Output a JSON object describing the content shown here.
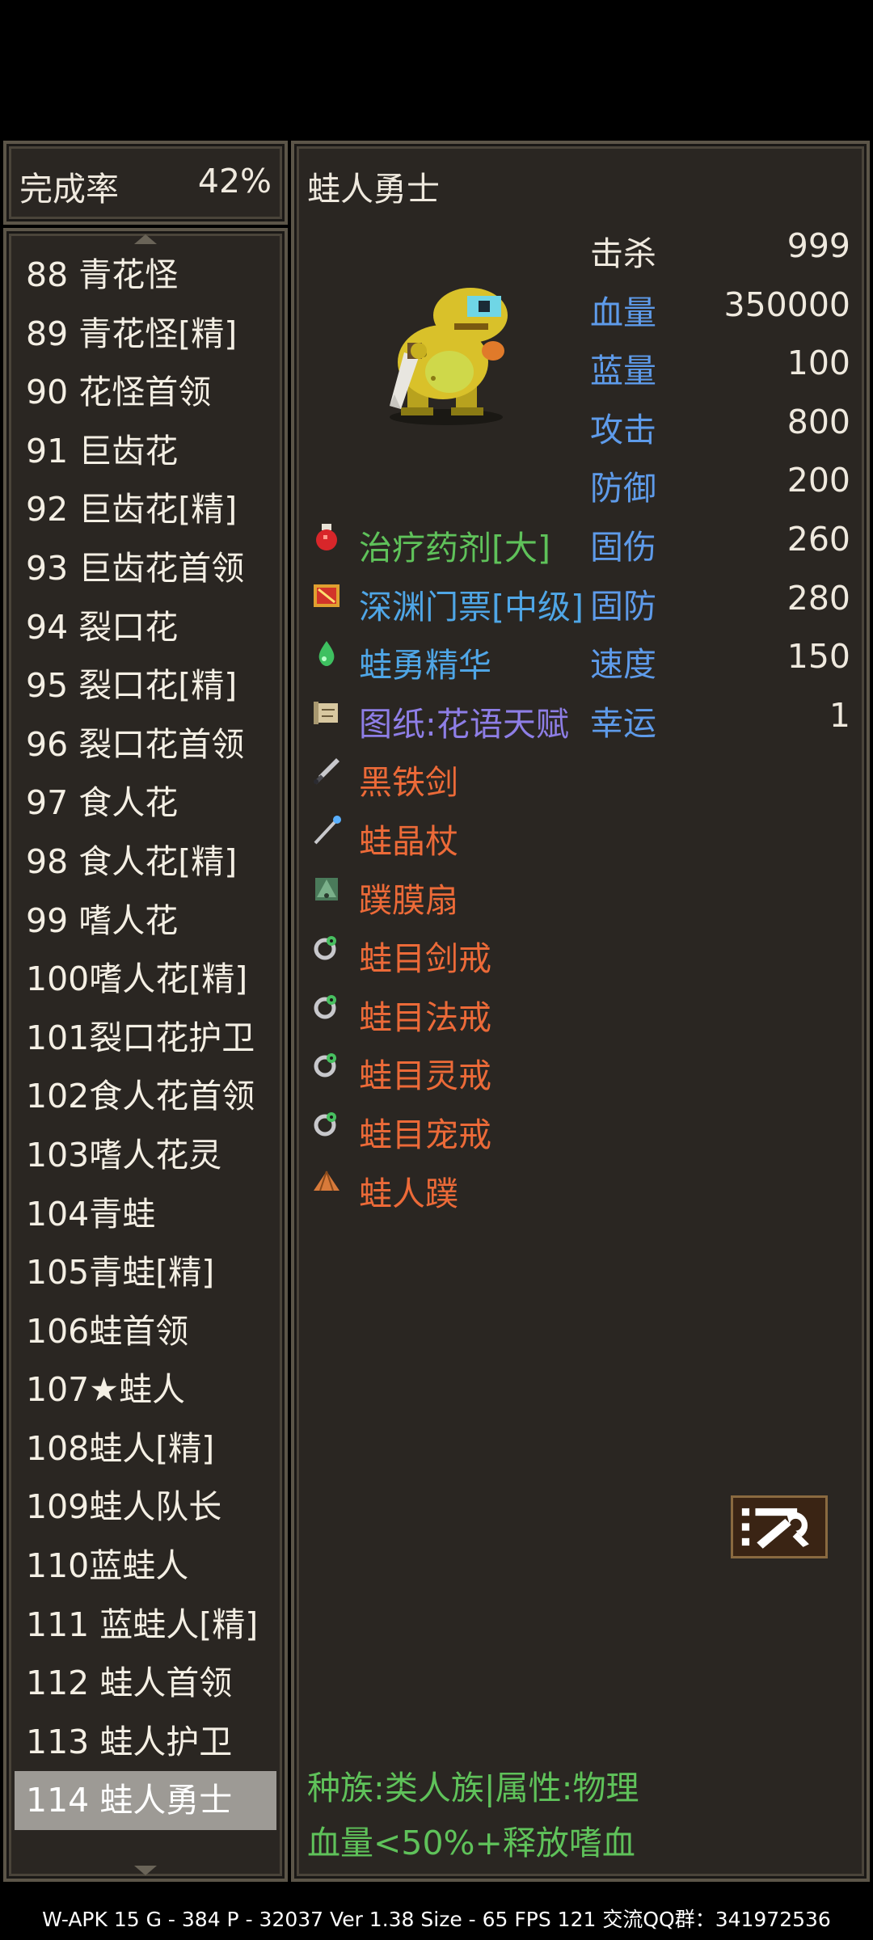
{
  "completion": {
    "label": "完成率",
    "value": "42%"
  },
  "monster_list": [
    "88 青花怪",
    "89 青花怪[精]",
    "90 花怪首领",
    "91 巨齿花",
    "92 巨齿花[精]",
    "93 巨齿花首领",
    "94 裂口花",
    "95 裂口花[精]",
    "96 裂口花首领",
    "97 食人花",
    "98 食人花[精]",
    "99 嗜人花",
    "100嗜人花[精]",
    "101裂口花护卫",
    "102食人花首领",
    "103嗜人花灵",
    "104青蛙",
    "105青蛙[精]",
    "106蛙首领",
    "107★蛙人",
    "108蛙人[精]",
    "109蛙人队长",
    "110蓝蛙人",
    "111 蓝蛙人[精]",
    "112 蛙人首领",
    "113 蛙人护卫",
    "114 蛙人勇士"
  ],
  "selected_index": 26,
  "monster_name": "蛙人勇士",
  "stats": [
    {
      "label": "击杀",
      "value": "999",
      "color": "#efe9de"
    },
    {
      "label": "血量",
      "value": "350000",
      "color": "#5e9bea"
    },
    {
      "label": "蓝量",
      "value": "100",
      "color": "#5e9bea"
    },
    {
      "label": "攻击",
      "value": "800",
      "color": "#5e9bea"
    },
    {
      "label": "防御",
      "value": "200",
      "color": "#5e9bea"
    },
    {
      "label": "固伤",
      "value": "260",
      "color": "#5e9bea"
    },
    {
      "label": "固防",
      "value": "280",
      "color": "#5e9bea"
    },
    {
      "label": "速度",
      "value": "150",
      "color": "#5e9bea"
    },
    {
      "label": "幸运",
      "value": "1",
      "color": "#5e9bea"
    }
  ],
  "drops": [
    {
      "name": "治疗药剂[大]",
      "color": "#5fc25a",
      "icon": "potion-icon"
    },
    {
      "name": "深渊门票[中级]",
      "color": "#4fa6e6",
      "icon": "ticket-icon"
    },
    {
      "name": "蛙勇精华",
      "color": "#4fa6e6",
      "icon": "essence-icon"
    },
    {
      "name": "图纸:花语天赋",
      "color": "#8e7ee6",
      "icon": "scroll-icon"
    },
    {
      "name": "黑铁剑",
      "color": "#ec6a38",
      "icon": "sword-icon"
    },
    {
      "name": "蛙晶杖",
      "color": "#ec6a38",
      "icon": "staff-icon"
    },
    {
      "name": "蹼膜扇",
      "color": "#ec6a38",
      "icon": "fan-icon"
    },
    {
      "name": "蛙目剑戒",
      "color": "#ec6a38",
      "icon": "ring-icon"
    },
    {
      "name": "蛙目法戒",
      "color": "#ec6a38",
      "icon": "ring-icon"
    },
    {
      "name": "蛙目灵戒",
      "color": "#ec6a38",
      "icon": "ring-icon"
    },
    {
      "name": "蛙目宠戒",
      "color": "#ec6a38",
      "icon": "ring-icon"
    },
    {
      "name": "蛙人蹼",
      "color": "#ec6a38",
      "icon": "web-icon"
    }
  ],
  "info": {
    "line1": "种族:类人族|属性:物理",
    "line2": "血量<50%+释放嗜血"
  },
  "status_bar": "W-APK 15    G - 384    P - 32037    Ver 1.38    Size - 65    FPS 121 交流QQ群：341972536"
}
